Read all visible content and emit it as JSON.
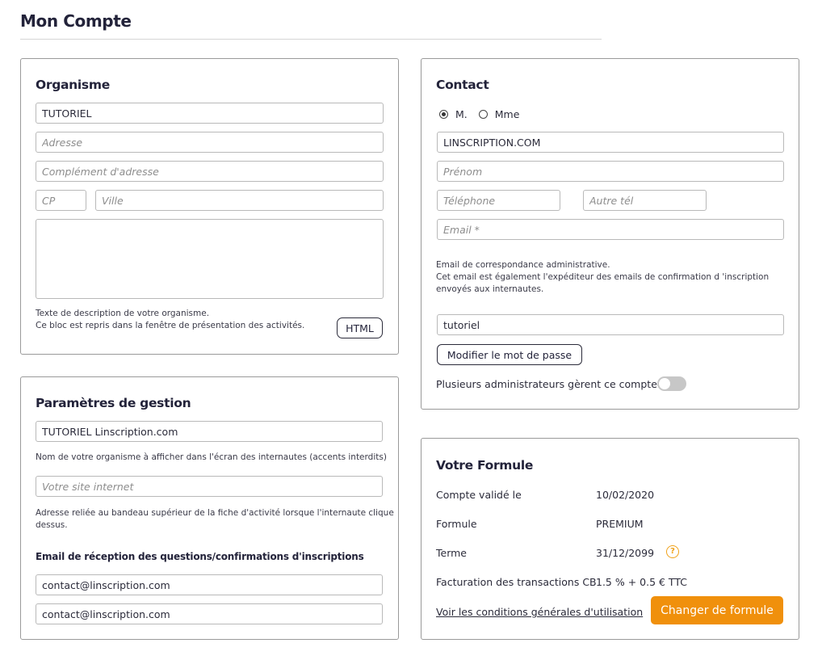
{
  "page": {
    "title": "Mon Compte"
  },
  "organisme": {
    "title": "Organisme",
    "name_value": "TUTORIEL",
    "address_placeholder": "Adresse",
    "complement_placeholder": "Complément d'adresse",
    "cp_placeholder": "CP",
    "ville_placeholder": "Ville",
    "description_value": "",
    "help_line1": "Texte de description de votre organisme.",
    "help_line2": "Ce bloc est repris dans la fenêtre de présentation des activités.",
    "html_button": "HTML"
  },
  "gestion": {
    "title": "Paramètres de gestion",
    "display_name_value": "TUTORIEL Linscription.com",
    "display_name_help": "Nom de votre organisme à afficher dans l'écran des internautes (accents interdits)",
    "site_placeholder": "Votre site internet",
    "site_help_line1": "Adresse reliée au bandeau supérieur de la fiche d'activité lorsque l'internaute clique",
    "site_help_line2": "dessus.",
    "email_label": "Email de réception des questions/confirmations d'inscriptions",
    "email1_value": "contact@linscription.com",
    "email2_value": "contact@linscription.com"
  },
  "contact": {
    "title": "Contact",
    "civility_m": "M.",
    "civility_mme": "Mme",
    "civility_selected": "M.",
    "nom_value": "LINSCRIPTION.COM",
    "prenom_placeholder": "Prénom",
    "telephone_placeholder": "Téléphone",
    "autre_tel_placeholder": "Autre tél",
    "email_placeholder": "Email *",
    "email_help_line1": "Email de correspondance administrative.",
    "email_help_line2": "Cet email est également l'expéditeur des emails de confirmation d 'inscription",
    "email_help_line3": "envoyés aux internautes.",
    "login_value": "tutoriel",
    "change_password_button": "Modifier le mot de passe",
    "multi_admin_label": "Plusieurs administrateurs gèrent ce compte",
    "multi_admin_enabled": false
  },
  "formule": {
    "title": "Votre Formule",
    "rows": [
      {
        "label": "Compte validé le",
        "value": "10/02/2020"
      },
      {
        "label": "Formule",
        "value": "PREMIUM"
      },
      {
        "label": "Terme",
        "value": "31/12/2099"
      },
      {
        "label": "Facturation des transactions CB",
        "value": "1.5 % + 0.5 € TTC"
      }
    ],
    "terme_help_icon": "question-icon",
    "cgu_link": "Voir les conditions générales d'utilisation",
    "change_button": "Changer de formule"
  },
  "colors": {
    "accent": "#f0900c",
    "border": "#9a9a9a",
    "toggle_off": "#c7c7c7"
  }
}
